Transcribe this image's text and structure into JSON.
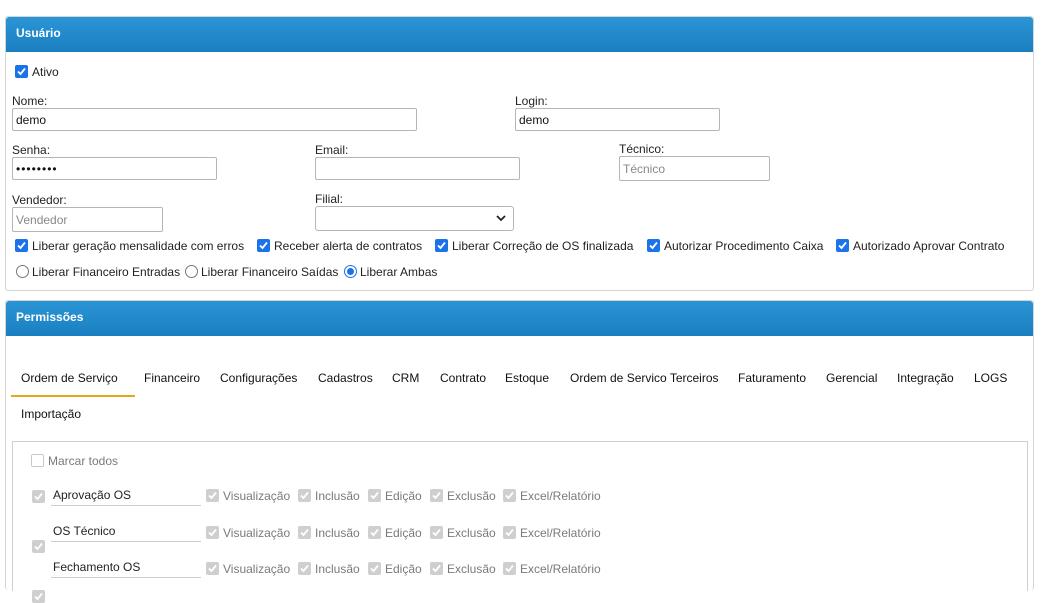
{
  "usuario": {
    "title": "Usuário",
    "ativo_label": "Ativo",
    "nome_label": "Nome:",
    "nome_value": "demo",
    "login_label": "Login:",
    "login_value": "demo",
    "senha_label": "Senha:",
    "senha_value": "••••••••",
    "email_label": "Email:",
    "email_value": "",
    "tecnico_label": "Técnico:",
    "tecnico_placeholder": "Técnico",
    "vendedor_label": "Vendedor:",
    "vendedor_placeholder": "Vendedor",
    "filial_label": "Filial:",
    "filial_value": "",
    "checkboxes": [
      {
        "label": "Liberar geração mensalidade com erros",
        "checked": true
      },
      {
        "label": "Receber alerta de contratos",
        "checked": true
      },
      {
        "label": "Liberar Correção de OS finalizada",
        "checked": true
      },
      {
        "label": "Autorizar Procedimento Caixa",
        "checked": true
      },
      {
        "label": "Autorizado Aprovar Contrato",
        "checked": true
      }
    ],
    "radios": [
      {
        "label": "Liberar Financeiro Entradas",
        "selected": false
      },
      {
        "label": "Liberar Financeiro Saídas",
        "selected": false
      },
      {
        "label": "Liberar Ambas",
        "selected": true
      }
    ]
  },
  "permissoes": {
    "title": "Permissões",
    "tabs": [
      "Ordem de Serviço",
      "Financeiro",
      "Configurações",
      "Cadastros",
      "CRM",
      "Contrato",
      "Estoque",
      "Ordem de Servico Terceiros",
      "Faturamento",
      "Gerencial",
      "Integração",
      "LOGS",
      "Importação"
    ],
    "active_tab": "Ordem de Serviço",
    "marcar_todos": "Marcar todos",
    "actions": [
      "Visualização",
      "Inclusão",
      "Edição",
      "Exclusão",
      "Excel/Relatório"
    ],
    "rows": [
      {
        "name": "Aprovação OS"
      },
      {
        "name": "OS Técnico"
      },
      {
        "name": "Fechamento OS"
      }
    ]
  },
  "colors": {
    "header": "#1e87c8",
    "tab_underline": "#e6a622",
    "checkbox": "#1a73e8"
  }
}
